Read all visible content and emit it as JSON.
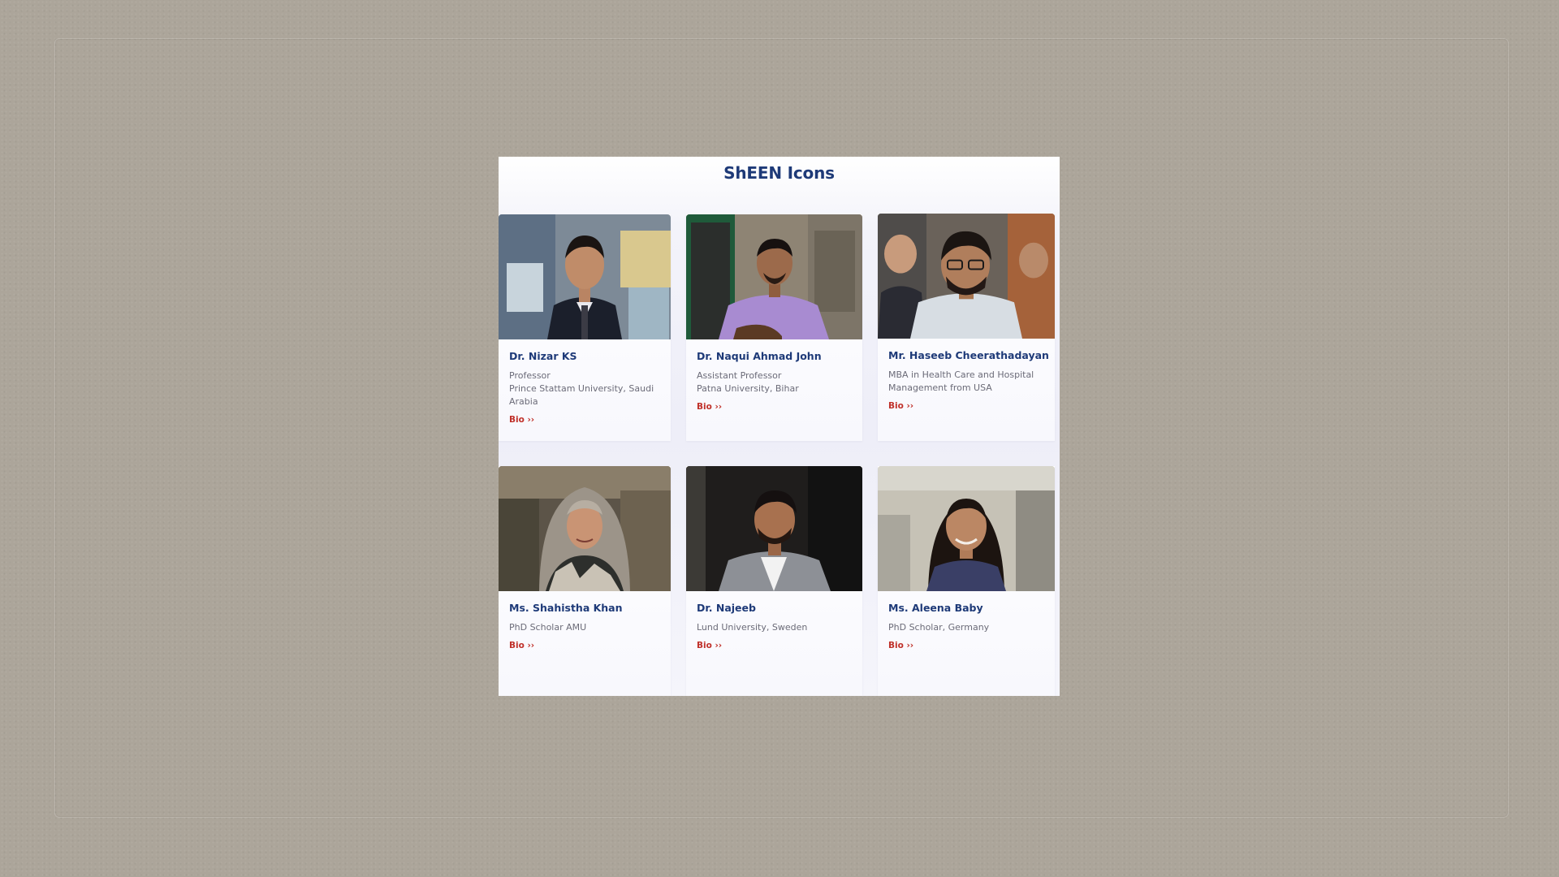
{
  "section": {
    "title": "ShEEN Icons"
  },
  "cards": [
    {
      "name": "Dr. Nizar KS",
      "lines": [
        "Professor",
        "Prince Stattam University, Saudi",
        "Arabia"
      ],
      "link": "Bio ››"
    },
    {
      "name": "Dr. Naqui Ahmad John",
      "lines": [
        "Assistant Professor",
        "Patna University, Bihar"
      ],
      "link": "Bio ››"
    },
    {
      "name": "Mr. Haseeb Cheerathadayan",
      "lines": [
        "MBA in Health Care and Hospital",
        "Management from USA"
      ],
      "link": "Bio ››"
    },
    {
      "name": "Ms. Shahistha Khan",
      "lines": [
        "PhD Scholar AMU"
      ],
      "link": "Bio ››"
    },
    {
      "name": "Dr. Najeeb",
      "lines": [
        "Lund University, Sweden"
      ],
      "link": "Bio ››"
    },
    {
      "name": "Ms. Aleena Baby",
      "lines": [
        "PhD Scholar, Germany"
      ],
      "link": "Bio ››"
    }
  ],
  "colors": {
    "heading": "#1e3a78",
    "link": "#c0312a",
    "body_text": "#6b6b78",
    "desk_background": "#aca59a"
  }
}
